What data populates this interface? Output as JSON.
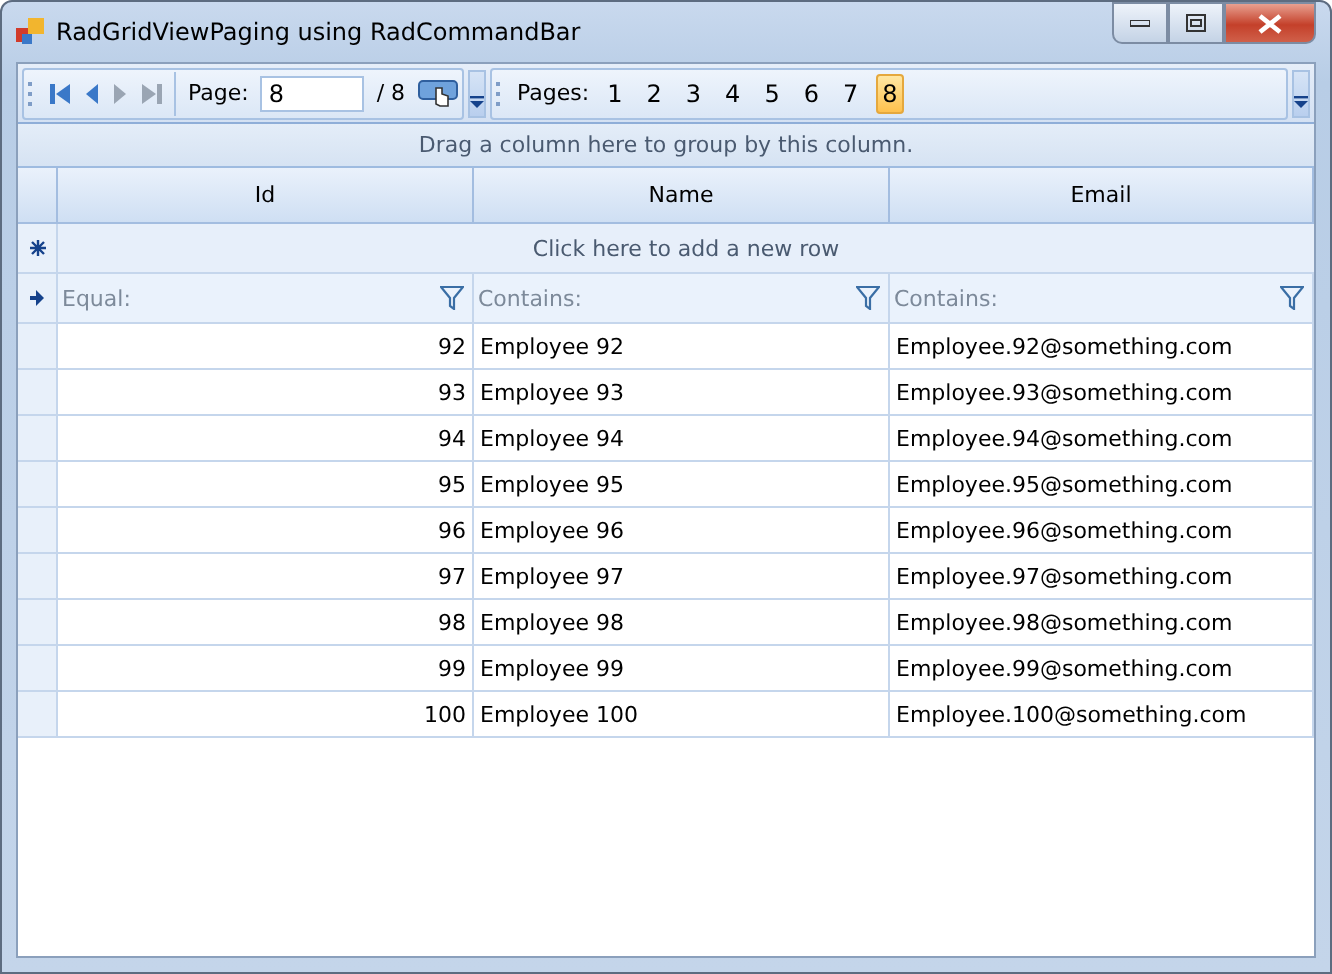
{
  "window": {
    "title": "RadGridViewPaging using RadCommandBar"
  },
  "pager": {
    "page_label": "Page:",
    "page_value": "8",
    "total": "/ 8",
    "pages_label": "Pages:",
    "pages": [
      {
        "label": "1",
        "selected": false
      },
      {
        "label": "2",
        "selected": false
      },
      {
        "label": "3",
        "selected": false
      },
      {
        "label": "4",
        "selected": false
      },
      {
        "label": "5",
        "selected": false
      },
      {
        "label": "6",
        "selected": false
      },
      {
        "label": "7",
        "selected": false
      },
      {
        "label": "8",
        "selected": true
      }
    ]
  },
  "grid": {
    "group_panel": "Drag a column here to group by this column.",
    "columns": [
      "Id",
      "Name",
      "Email"
    ],
    "new_row": "Click here to add a new row",
    "filters": [
      {
        "placeholder": "Equal:"
      },
      {
        "placeholder": "Contains:"
      },
      {
        "placeholder": "Contains:"
      }
    ],
    "rows": [
      [
        "92",
        "Employee 92",
        "Employee.92@something.com"
      ],
      [
        "93",
        "Employee 93",
        "Employee.93@something.com"
      ],
      [
        "94",
        "Employee 94",
        "Employee.94@something.com"
      ],
      [
        "95",
        "Employee 95",
        "Employee.95@something.com"
      ],
      [
        "96",
        "Employee 96",
        "Employee.96@something.com"
      ],
      [
        "97",
        "Employee 97",
        "Employee.97@something.com"
      ],
      [
        "98",
        "Employee 98",
        "Employee.98@something.com"
      ],
      [
        "99",
        "Employee 99",
        "Employee.99@something.com"
      ],
      [
        "100",
        "Employee 100",
        "Employee.100@something.com"
      ]
    ]
  }
}
